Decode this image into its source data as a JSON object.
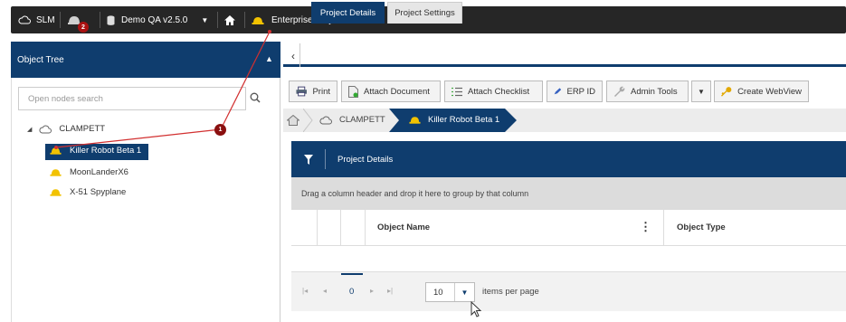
{
  "topbar": {
    "slm_label": "SLM",
    "notification_count": "2",
    "database_label": "Demo QA v2.5.0",
    "project_label": "Enterprise Projects"
  },
  "left_panel": {
    "title": "Object Tree",
    "search_placeholder": "Open nodes search",
    "root_node": "CLAMPETT",
    "children": [
      "Killer Robot Beta 1",
      "MoonLanderX6",
      "X-51 Spyplane"
    ],
    "callout_number": "1"
  },
  "tabs": [
    "Project Details",
    "Project Settings"
  ],
  "toolbar": {
    "print": "Print",
    "attach_document": "Attach Document",
    "attach_checklist": "Attach Checklist",
    "erp_id": "ERP ID",
    "admin_tools": "Admin Tools",
    "create_webview": "Create WebView"
  },
  "breadcrumb": [
    "CLAMPETT",
    "Killer Robot Beta 1"
  ],
  "grid": {
    "title": "Project Details",
    "group_hint": "Drag a column header and drop it here to group by that column",
    "columns": [
      "Object Name",
      "Object Type"
    ],
    "page_number": "0",
    "page_size": "10",
    "items_per_page_label": "items per page"
  },
  "colors": {
    "nav_blue": "#0f3d6e",
    "topbar_dark": "#262626",
    "badge_red": "#a11111",
    "callout_line": "#d23030",
    "helmet_yellow": "#f2c200"
  }
}
